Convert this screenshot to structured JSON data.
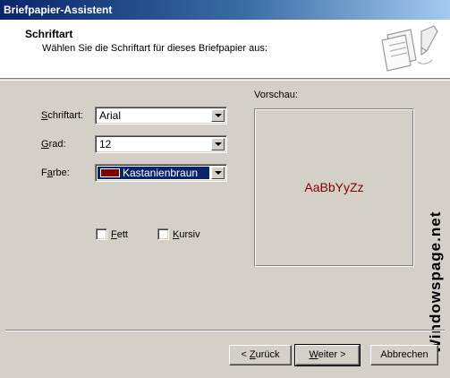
{
  "window": {
    "title": "Briefpapier-Assistent"
  },
  "header": {
    "title": "Schriftart",
    "subtitle": "Wählen Sie die Schriftart für dieses Briefpapier aus:",
    "icon": "stationery-pen-icon"
  },
  "form": {
    "font": {
      "label": "Schriftart:",
      "value": "Arial"
    },
    "size": {
      "label": "Grad:",
      "value": "12"
    },
    "color": {
      "label": "Farbe:",
      "value": "Kastanienbraun",
      "swatch": "#800000"
    },
    "bold": {
      "label": "Fett",
      "checked": false
    },
    "italic": {
      "label": "Kursiv",
      "checked": false
    }
  },
  "preview": {
    "label": "Vorschau:",
    "sample": "AaBbYyZz",
    "color": "#800000"
  },
  "watermark": "Windowspage.net",
  "buttons": {
    "back": "< Zurück",
    "next": "Weiter >",
    "cancel": "Abbrechen"
  },
  "colors": {
    "titlebar_start": "#0a246a",
    "titlebar_end": "#a6caf0",
    "dialog_bg": "#d4d0c8",
    "selection": "#0a246a"
  }
}
